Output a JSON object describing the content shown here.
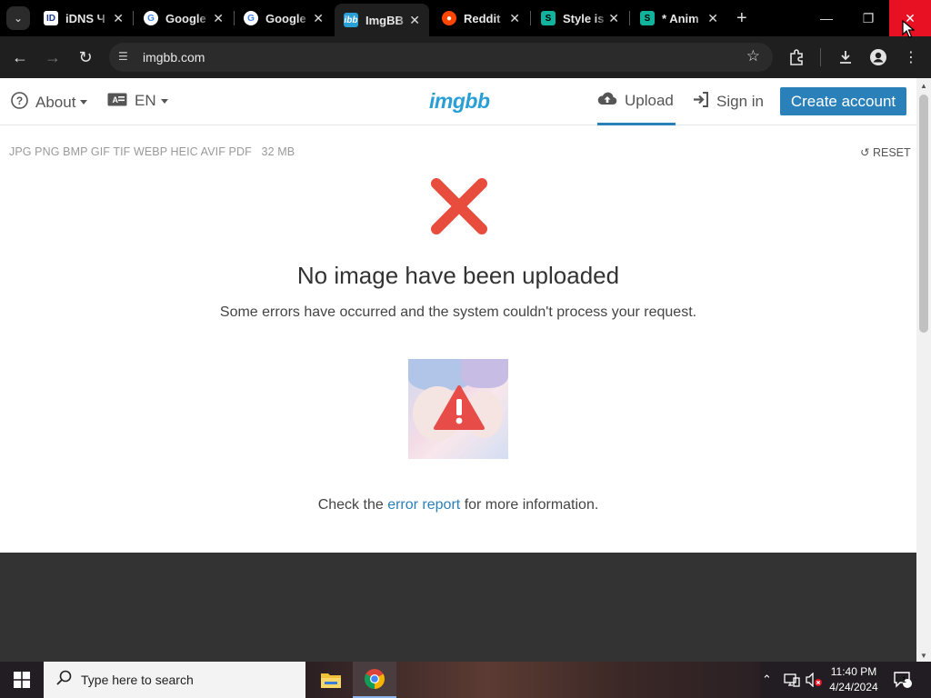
{
  "browser": {
    "tabs": [
      {
        "title": "iDNS Ч",
        "favicon": "idns-favicon"
      },
      {
        "title": "Google",
        "favicon": "google-favicon"
      },
      {
        "title": "Google",
        "favicon": "google-favicon"
      },
      {
        "title": "ImgBB",
        "favicon": "imgbb-favicon",
        "active": true
      },
      {
        "title": "Reddit",
        "favicon": "reddit-favicon"
      },
      {
        "title": "Style is",
        "favicon": "style-favicon"
      },
      {
        "title": "* Anim",
        "favicon": "style-favicon"
      }
    ],
    "url": "imgbb.com"
  },
  "site": {
    "nav": {
      "about": "About",
      "lang": "EN",
      "logo": "imgbb",
      "upload": "Upload",
      "signin": "Sign in",
      "create": "Create account"
    },
    "formats": "JPG PNG BMP GIF TIF WEBP HEIC AVIF PDF",
    "max_size": "32 MB",
    "reset": "RESET",
    "headline": "No image have been uploaded",
    "subline": "Some errors have occurred and the system couldn't process your request.",
    "check_prefix": "Check the",
    "check_link": "error report",
    "check_suffix": "for more information."
  },
  "taskbar": {
    "search_placeholder": "Type here to search",
    "time": "11:40 PM",
    "date": "4/24/2024",
    "notification_count": "1"
  },
  "colors": {
    "accent": "#2a80b9",
    "logo": "#2a9fd6",
    "error_red": "#e74c3c",
    "close_red": "#e81123"
  }
}
